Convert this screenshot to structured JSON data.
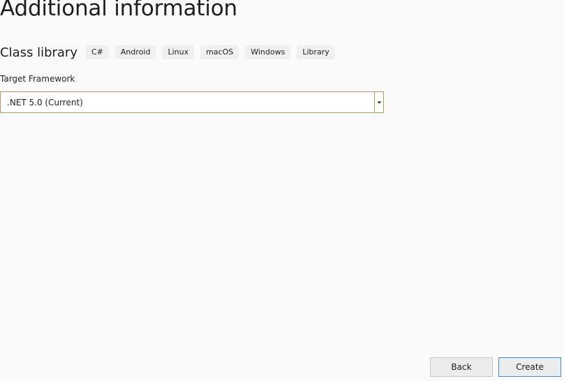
{
  "page": {
    "title": "Additional information"
  },
  "template": {
    "name": "Class library",
    "tags": [
      "C#",
      "Android",
      "Linux",
      "macOS",
      "Windows",
      "Library"
    ]
  },
  "framework": {
    "label": "Target Framework",
    "selected": ".NET 5.0 (Current)"
  },
  "footer": {
    "back_label": "Back",
    "create_label": "Create"
  },
  "colors": {
    "background": "#fafafa",
    "select_border": "#b8985c",
    "create_border": "#3b8fd8",
    "tag_background": "#f0f0f0"
  },
  "icons": {
    "dropdown": "dropdown-arrow-icon"
  }
}
